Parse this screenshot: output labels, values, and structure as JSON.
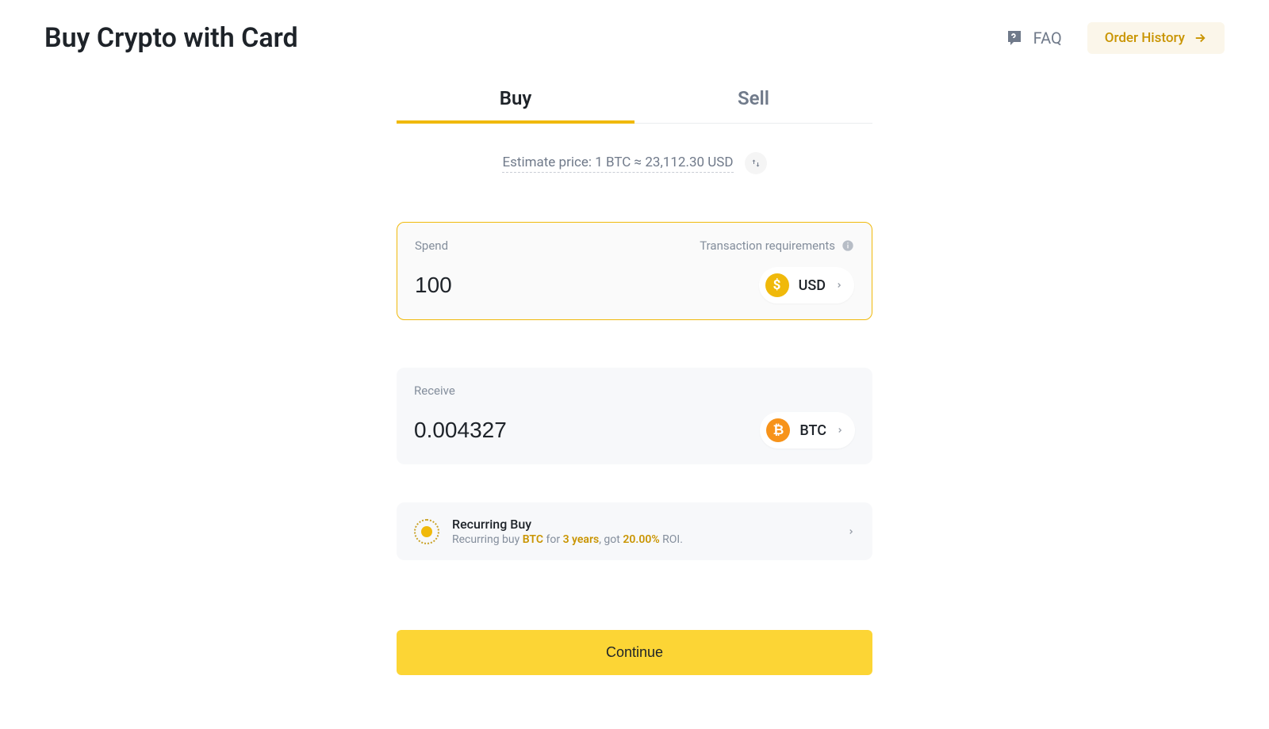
{
  "header": {
    "title": "Buy Crypto with Card",
    "faq_label": "FAQ",
    "order_history_label": "Order History"
  },
  "tabs": {
    "buy": "Buy",
    "sell": "Sell",
    "active": "buy"
  },
  "estimate": {
    "text": "Estimate price: 1 BTC ≈ 23,112.30 USD"
  },
  "spend": {
    "label": "Spend",
    "tx_req_label": "Transaction requirements",
    "value": "100",
    "currency": "USD"
  },
  "receive": {
    "label": "Receive",
    "value": "0.004327",
    "currency": "BTC"
  },
  "recurring": {
    "title": "Recurring Buy",
    "sub_prefix": "Recurring buy ",
    "asset": "BTC",
    "for_text": " for ",
    "duration": "3 years",
    "got_text": ", got ",
    "roi": "20.00%",
    "roi_suffix": " ROI."
  },
  "cta": {
    "continue": "Continue"
  }
}
